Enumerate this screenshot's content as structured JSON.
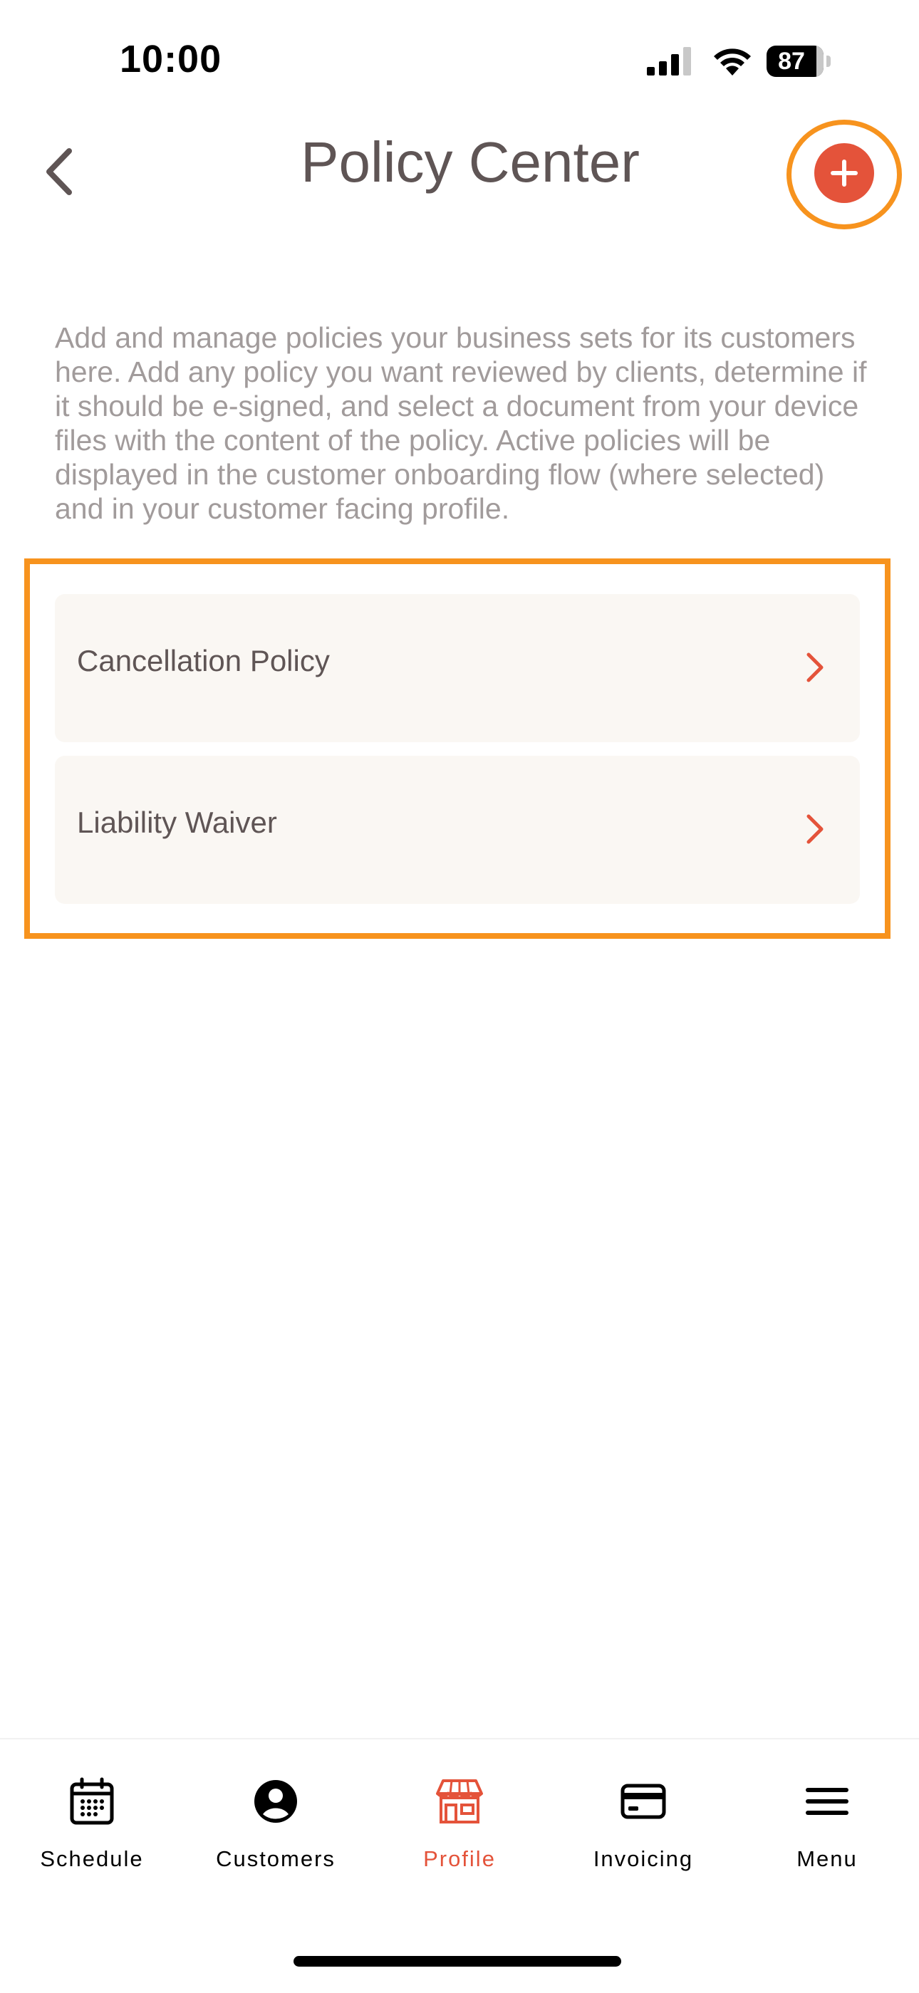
{
  "status_bar": {
    "time": "10:00",
    "battery_level": "87"
  },
  "header": {
    "title": "Policy Center",
    "back_icon": "chevron-left-icon",
    "add_icon": "plus-icon",
    "accent_color": "#e4533a",
    "highlight_color": "#f7931e"
  },
  "description": "Add and manage policies your business sets for its customers here. Add any policy you want reviewed by clients, determine if it should be e-signed, and select a document from your device files with the content of the policy. Active policies will be displayed in the customer onboarding flow (where selected) and in your customer facing profile.",
  "policies": [
    {
      "label": "Cancellation Policy"
    },
    {
      "label": "Liability Waiver"
    }
  ],
  "tab_bar": {
    "active": "Profile",
    "items": [
      {
        "label": "Schedule",
        "icon": "calendar-icon"
      },
      {
        "label": "Customers",
        "icon": "user-circle-icon"
      },
      {
        "label": "Profile",
        "icon": "storefront-icon"
      },
      {
        "label": "Invoicing",
        "icon": "credit-card-icon"
      },
      {
        "label": "Menu",
        "icon": "hamburger-menu-icon"
      }
    ]
  }
}
